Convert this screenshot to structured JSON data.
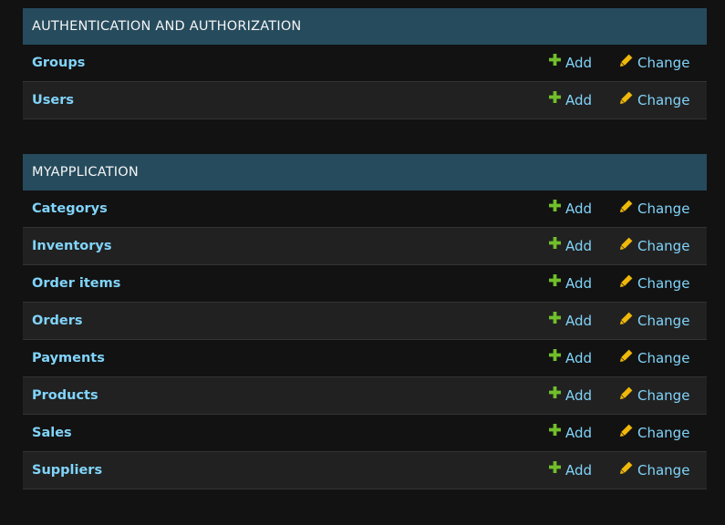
{
  "modules": [
    {
      "caption": "AUTHENTICATION AND AUTHORIZATION",
      "models": [
        {
          "name": "Groups",
          "add_label": "Add",
          "change_label": "Change"
        },
        {
          "name": "Users",
          "add_label": "Add",
          "change_label": "Change"
        }
      ]
    },
    {
      "caption": "MYAPPLICATION",
      "models": [
        {
          "name": "Categorys",
          "add_label": "Add",
          "change_label": "Change"
        },
        {
          "name": "Inventorys",
          "add_label": "Add",
          "change_label": "Change"
        },
        {
          "name": "Order items",
          "add_label": "Add",
          "change_label": "Change"
        },
        {
          "name": "Orders",
          "add_label": "Add",
          "change_label": "Change"
        },
        {
          "name": "Payments",
          "add_label": "Add",
          "change_label": "Change"
        },
        {
          "name": "Products",
          "add_label": "Add",
          "change_label": "Change"
        },
        {
          "name": "Sales",
          "add_label": "Add",
          "change_label": "Change"
        },
        {
          "name": "Suppliers",
          "add_label": "Add",
          "change_label": "Change"
        }
      ]
    }
  ],
  "icons": {
    "add": "plus-icon",
    "change": "pencil-icon"
  },
  "colors": {
    "background": "#121212",
    "caption_bg": "#264b5d",
    "link": "#81d4fa",
    "add_icon": "#70bf2b",
    "change_icon": "#efb80b"
  }
}
